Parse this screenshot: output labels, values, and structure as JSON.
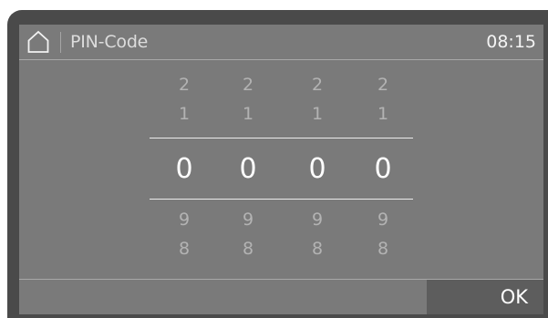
{
  "header": {
    "home_icon": "home-icon",
    "title": "PIN-Code",
    "time": "08:15"
  },
  "pin_wheels": [
    {
      "above": [
        "2",
        "1"
      ],
      "value": "0",
      "below": [
        "9",
        "8"
      ]
    },
    {
      "above": [
        "2",
        "1"
      ],
      "value": "0",
      "below": [
        "9",
        "8"
      ]
    },
    {
      "above": [
        "2",
        "1"
      ],
      "value": "0",
      "below": [
        "9",
        "8"
      ]
    },
    {
      "above": [
        "2",
        "1"
      ],
      "value": "0",
      "below": [
        "9",
        "8"
      ]
    }
  ],
  "footer": {
    "ok_label": "OK"
  },
  "colors": {
    "bezel": "#4a4a4a",
    "screen_background": "#7a7a7a",
    "ok_button_background": "#5d5d5d",
    "dim_digit": "#b3b3b3",
    "selected_digit": "#ffffff"
  }
}
